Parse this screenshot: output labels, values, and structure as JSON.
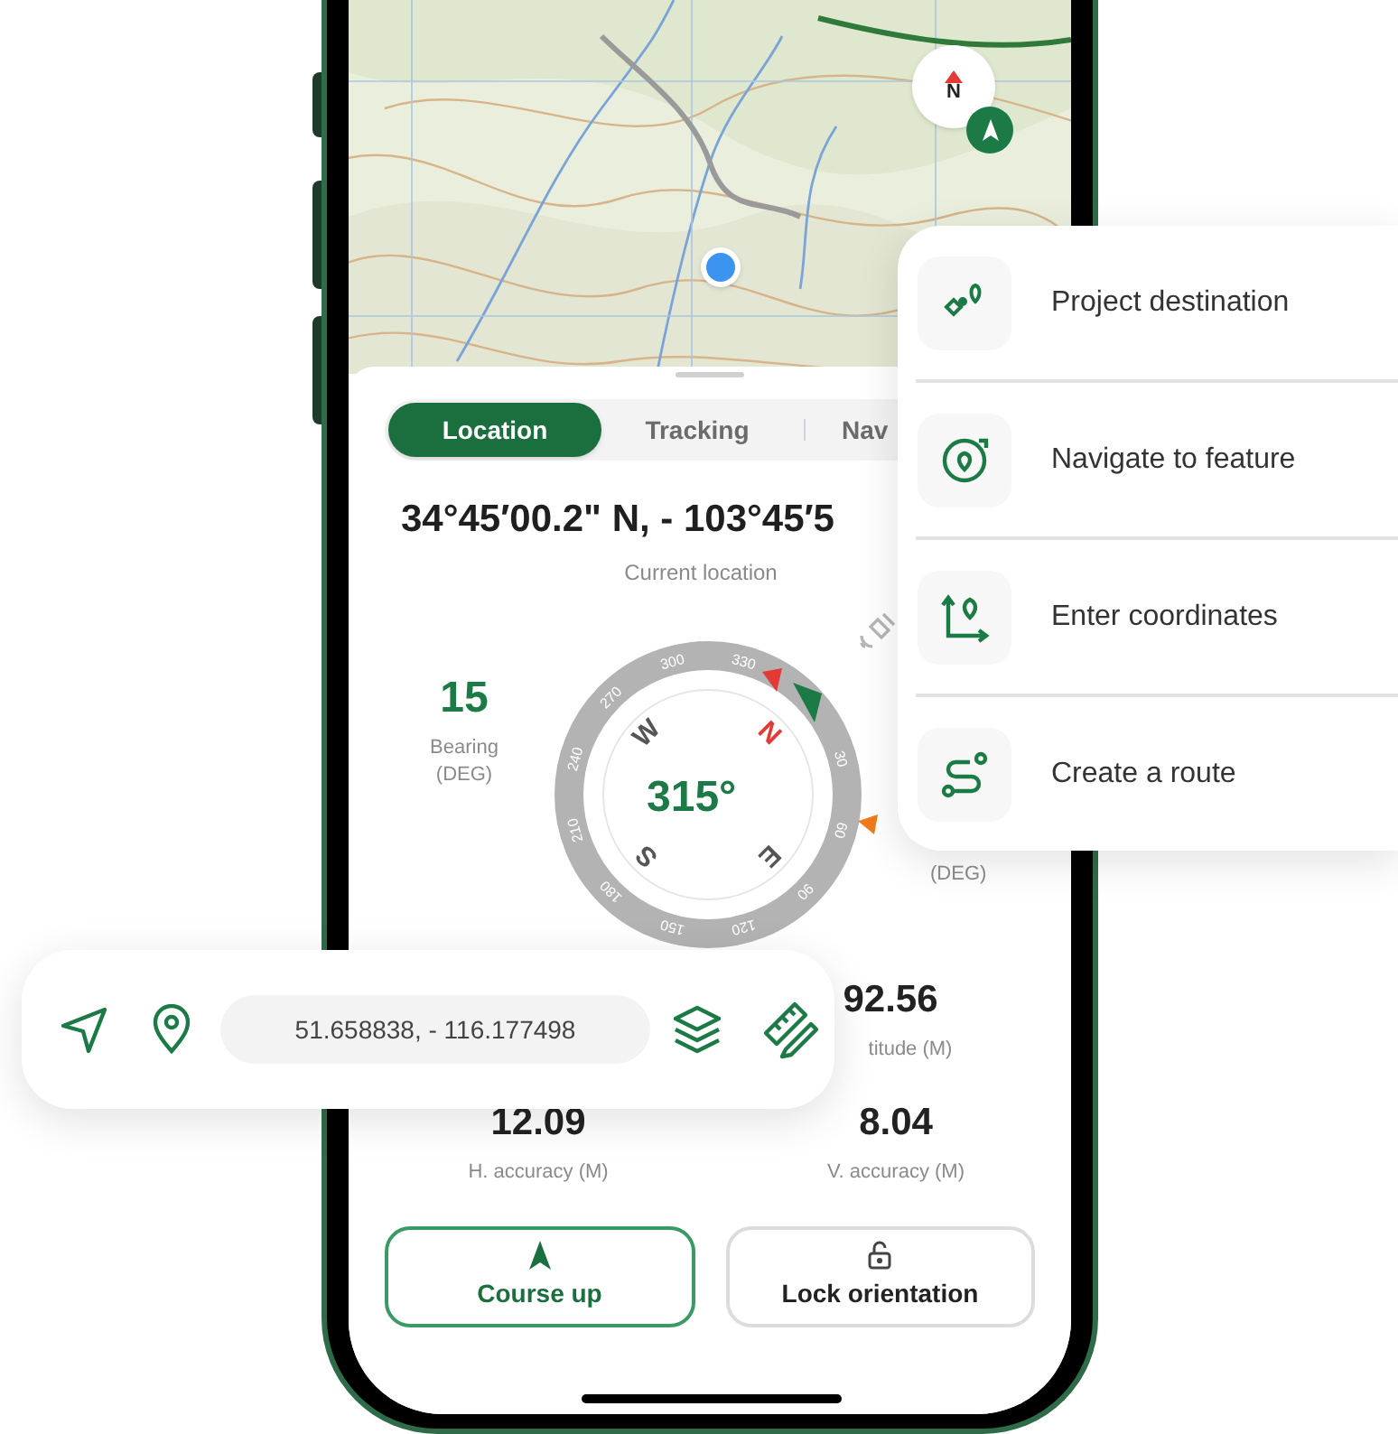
{
  "map": {
    "compass_label": "N"
  },
  "tabs": [
    {
      "label": "Location",
      "selected": true
    },
    {
      "label": "Tracking",
      "selected": false
    },
    {
      "label": "Nav",
      "selected": false
    }
  ],
  "coordinates": "34°45′00.2\" N, - 103°45′5",
  "coordinates_label": "Current location",
  "bearing": {
    "value": "15",
    "label": "Bearing (DEG)"
  },
  "right_unit": "(DEG)",
  "compass": {
    "heading": "315°",
    "cardinals": [
      {
        "label": "N",
        "kind": "north"
      },
      {
        "label": "E",
        "kind": "plain"
      },
      {
        "label": "S",
        "kind": "plain"
      },
      {
        "label": "W",
        "kind": "plain"
      }
    ],
    "dial_labels": [
      "30",
      "60",
      "90",
      "120",
      "150",
      "180",
      "210",
      "240",
      "270",
      "300",
      "330"
    ]
  },
  "altitude": {
    "value": "92.56",
    "label": "titude (M)"
  },
  "accuracy": [
    {
      "value": "12.09",
      "label": "H. accuracy (M)"
    },
    {
      "value": "8.04",
      "label": "V. accuracy (M)"
    }
  ],
  "buttons": [
    {
      "label": "Course up",
      "kind": "course",
      "selected": true
    },
    {
      "label": "Lock orientation",
      "kind": "lock",
      "selected": false
    }
  ],
  "search_bar": {
    "value": "51.658838, - 116.177498"
  },
  "menu": [
    {
      "label": "Project destination",
      "kind": "project"
    },
    {
      "label": "Navigate to feature",
      "kind": "feature"
    },
    {
      "label": "Enter coordinates",
      "kind": "coordinates"
    },
    {
      "label": "Create a route",
      "kind": "route"
    }
  ]
}
